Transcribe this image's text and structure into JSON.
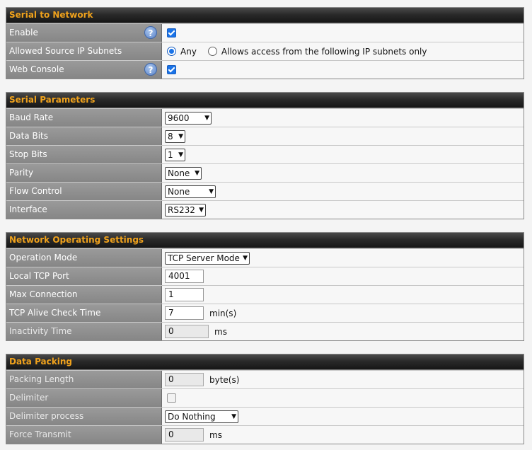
{
  "serial_network": {
    "title": "Serial to Network",
    "enable_label": "Enable",
    "allowed_label": "Allowed Source IP Subnets",
    "allowed_any": "Any",
    "allowed_specific": "Allows access from the following IP subnets only",
    "web_console_label": "Web Console",
    "help_glyph": "?"
  },
  "serial_params": {
    "title": "Serial Parameters",
    "rows": [
      {
        "label": "Baud Rate",
        "value": "9600"
      },
      {
        "label": "Data Bits",
        "value": "8"
      },
      {
        "label": "Stop Bits",
        "value": "1"
      },
      {
        "label": "Parity",
        "value": "None"
      },
      {
        "label": "Flow Control",
        "value": "None"
      },
      {
        "label": "Interface",
        "value": "RS232"
      }
    ]
  },
  "network_settings": {
    "title": "Network Operating Settings",
    "operation_mode_label": "Operation Mode",
    "operation_mode_value": "TCP Server Mode",
    "local_port_label": "Local TCP Port",
    "local_port_value": "4001",
    "max_conn_label": "Max Connection",
    "max_conn_value": "1",
    "alive_label": "TCP Alive Check Time",
    "alive_value": "7",
    "alive_unit": "min(s)",
    "inactivity_label": "Inactivity Time",
    "inactivity_value": "0",
    "inactivity_unit": "ms"
  },
  "data_packing": {
    "title": "Data Packing",
    "packing_length_label": "Packing Length",
    "packing_length_value": "0",
    "packing_length_unit": "byte(s)",
    "delimiter_label": "Delimiter",
    "delimiter_process_label": "Delimiter process",
    "delimiter_process_value": "Do Nothing",
    "force_transmit_label": "Force Transmit",
    "force_transmit_value": "0",
    "force_transmit_unit": "ms"
  },
  "colors": {
    "header_text": "#f0a21c",
    "label_bg": "#8e8e8e",
    "checkbox_blue": "#1a73e8"
  }
}
